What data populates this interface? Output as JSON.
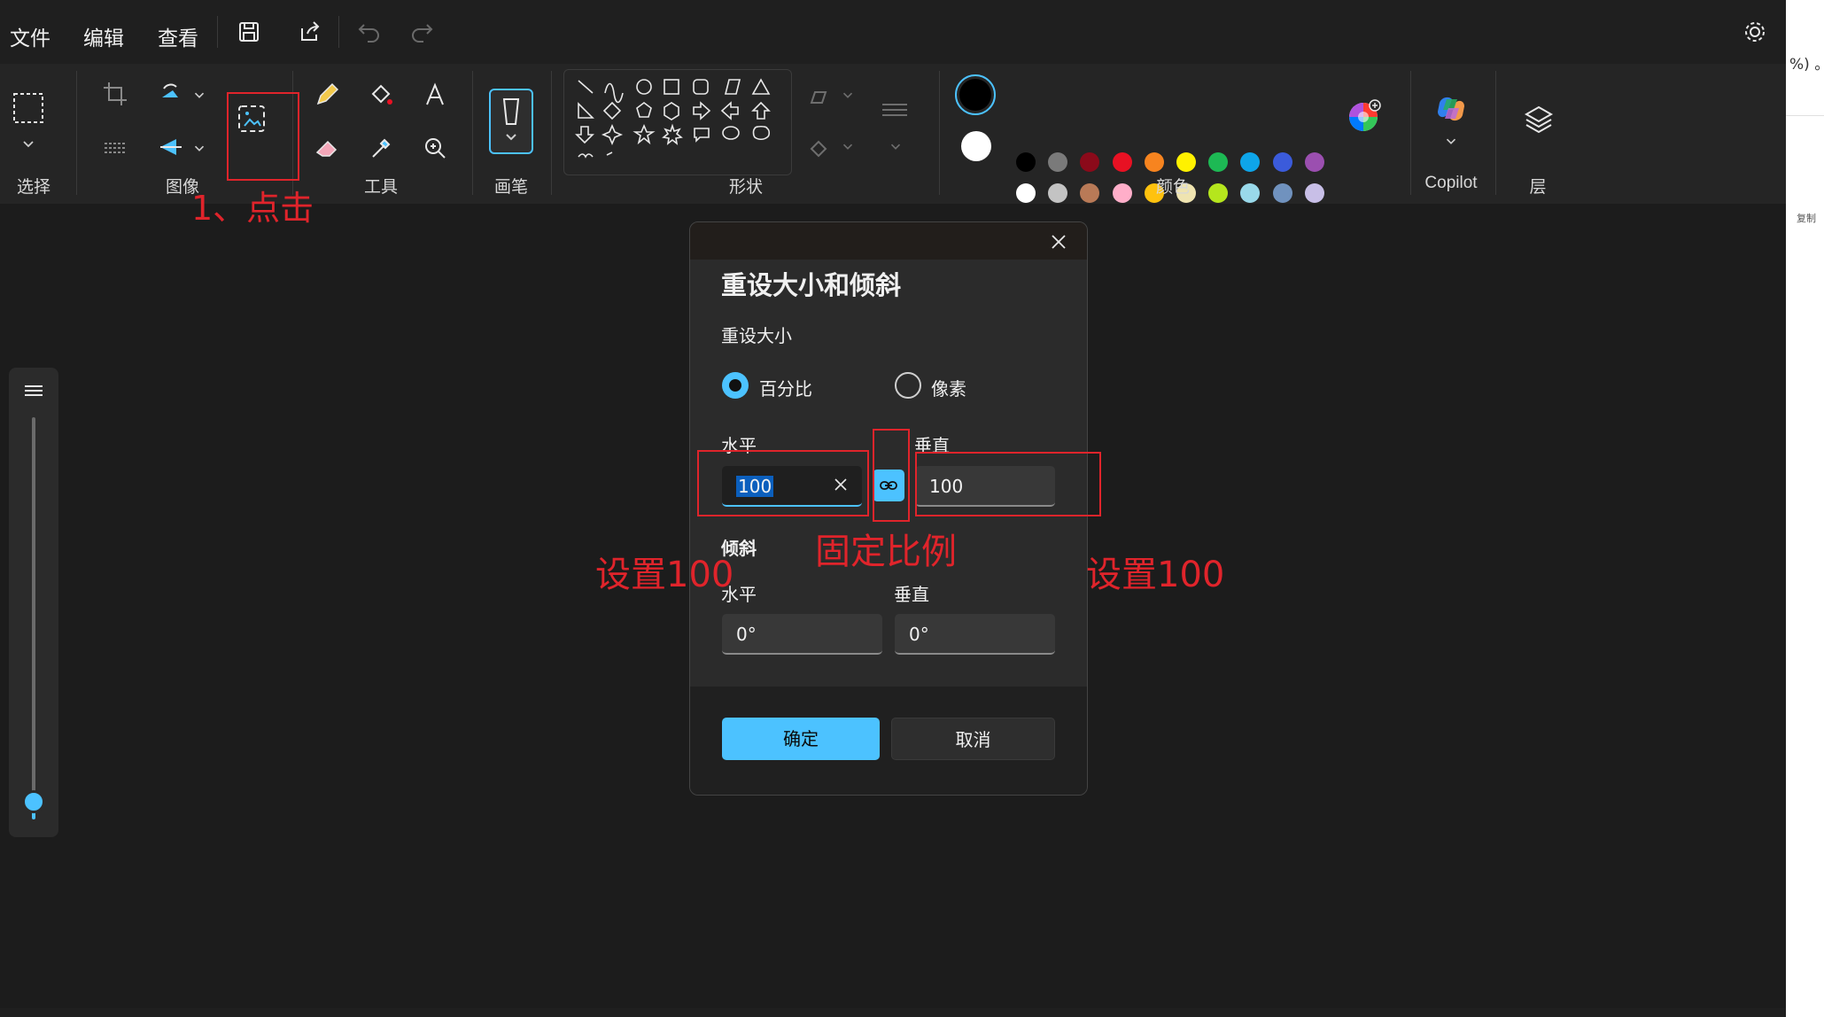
{
  "menu": {
    "file": "文件",
    "edit": "编辑",
    "view": "查看"
  },
  "ribbon": {
    "groups": {
      "select": "选择",
      "image": "图像",
      "tools": "工具",
      "brushes": "画笔",
      "shapes": "形状",
      "colors": "颜色",
      "copilot": "Copilot",
      "layers": "层"
    },
    "colors_row1": [
      "#000000",
      "#7a7a7a",
      "#8b0a1a",
      "#e81123",
      "#f7841f",
      "#fff100",
      "#1db954",
      "#0ea5e9",
      "#3b5bdb",
      "#9b4fb0"
    ],
    "colors_row2": [
      "#ffffff",
      "#c3c3c3",
      "#b97a57",
      "#ffaec9",
      "#ffc20e",
      "#efe4b0",
      "#b5e61d",
      "#99d9ea",
      "#7092be",
      "#c8bfe7"
    ],
    "primary_color": "#000000",
    "secondary_color": "#ffffff",
    "accent": "#4cc2ff"
  },
  "right_strip": {
    "top_text": "%) 。",
    "mid_text": "复制"
  },
  "dialog": {
    "title": "重设大小和倾斜",
    "resize_section": "重设大小",
    "radio_percent": "百分比",
    "radio_pixels": "像素",
    "selected": "百分比",
    "horizontal_label": "水平",
    "vertical_label": "垂直",
    "horizontal_value": "100",
    "vertical_value": "100",
    "lock_aspect_ratio": true,
    "skew_section": "倾斜",
    "skew_horizontal_label": "水平",
    "skew_vertical_label": "垂直",
    "skew_horizontal_value": "0°",
    "skew_vertical_value": "0°",
    "ok": "确定",
    "cancel": "取消"
  },
  "annotations": {
    "step1": "1、点击",
    "left": "设置100",
    "center": "固定比例",
    "right": "设置100"
  }
}
